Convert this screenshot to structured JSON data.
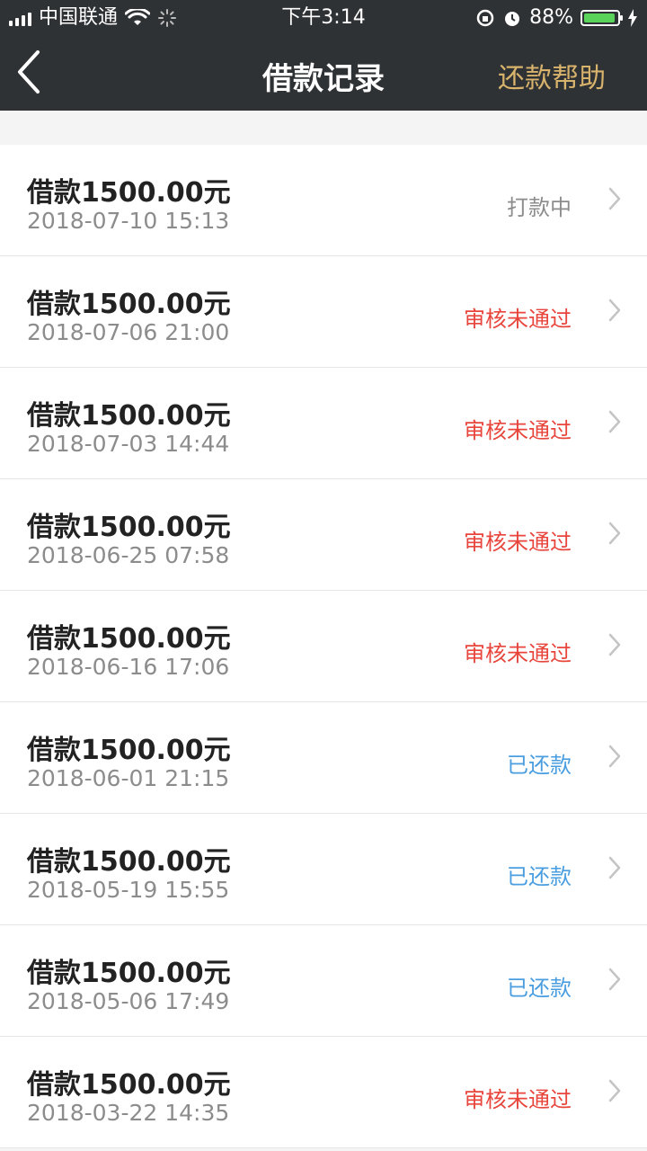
{
  "status_bar": {
    "carrier": "中国联通",
    "time": "下午3:14",
    "battery_percent": "88%",
    "battery_level": 0.88,
    "icons": [
      "signal-icon",
      "wifi-icon",
      "loading-icon",
      "lock-rotation-icon",
      "alarm-icon",
      "battery-icon",
      "charging-icon"
    ]
  },
  "nav": {
    "title": "借款记录",
    "help_label": "还款帮助",
    "back_icon": "back-arrow-icon"
  },
  "colors": {
    "header_bg": "#2f3235",
    "help_color": "#d8b36b",
    "status_pending": "#8c8c8c",
    "status_rejected": "#e8453c",
    "status_repaid": "#4a9ee0"
  },
  "records": [
    {
      "title": "借款1500.00元",
      "date": "2018-07-10 15:13",
      "status": "打款中",
      "status_type": "pending"
    },
    {
      "title": "借款1500.00元",
      "date": "2018-07-06 21:00",
      "status": "审核未通过",
      "status_type": "rejected"
    },
    {
      "title": "借款1500.00元",
      "date": "2018-07-03 14:44",
      "status": "审核未通过",
      "status_type": "rejected"
    },
    {
      "title": "借款1500.00元",
      "date": "2018-06-25 07:58",
      "status": "审核未通过",
      "status_type": "rejected"
    },
    {
      "title": "借款1500.00元",
      "date": "2018-06-16 17:06",
      "status": "审核未通过",
      "status_type": "rejected"
    },
    {
      "title": "借款1500.00元",
      "date": "2018-06-01 21:15",
      "status": "已还款",
      "status_type": "repaid"
    },
    {
      "title": "借款1500.00元",
      "date": "2018-05-19 15:55",
      "status": "已还款",
      "status_type": "repaid"
    },
    {
      "title": "借款1500.00元",
      "date": "2018-05-06 17:49",
      "status": "已还款",
      "status_type": "repaid"
    },
    {
      "title": "借款1500.00元",
      "date": "2018-03-22 14:35",
      "status": "审核未通过",
      "status_type": "rejected"
    }
  ]
}
